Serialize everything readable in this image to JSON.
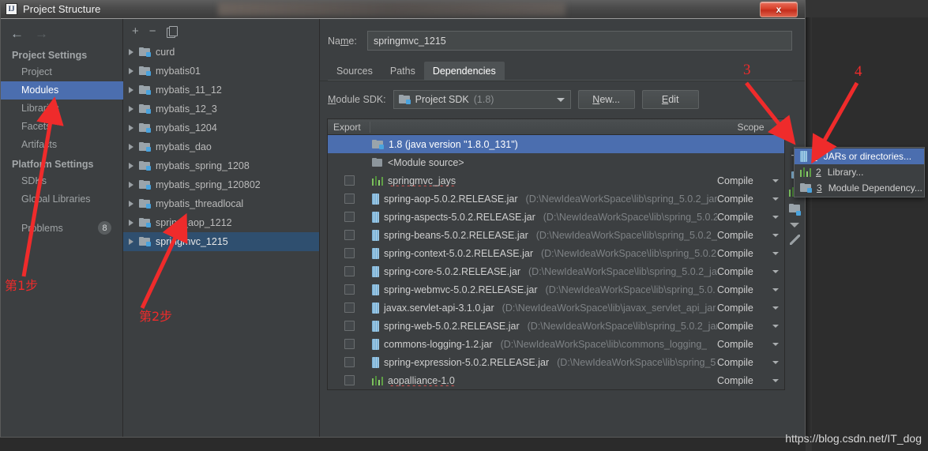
{
  "window": {
    "title": "Project Structure",
    "app_icon": "intellij-idea-icon",
    "close_label": "x"
  },
  "sidebar": {
    "back_icon": "arrow-left-icon",
    "forward_icon": "arrow-right-icon",
    "groups": [
      {
        "header": "Project Settings",
        "items": [
          {
            "label": "Project",
            "selected": false
          },
          {
            "label": "Modules",
            "selected": true
          },
          {
            "label": "Libraries",
            "selected": false
          },
          {
            "label": "Facets",
            "selected": false
          },
          {
            "label": "Artifacts",
            "selected": false
          }
        ]
      },
      {
        "header": "Platform Settings",
        "items": [
          {
            "label": "SDKs",
            "selected": false
          },
          {
            "label": "Global Libraries",
            "selected": false
          }
        ]
      }
    ],
    "problems": {
      "label": "Problems",
      "count": "8"
    }
  },
  "modules_panel": {
    "toolbar": {
      "add": "+",
      "remove": "−",
      "copy_icon": "copy-icon"
    },
    "items": [
      {
        "label": "curd",
        "selected": false
      },
      {
        "label": "mybatis01",
        "selected": false
      },
      {
        "label": "mybatis_11_12",
        "selected": false
      },
      {
        "label": "mybatis_12_3",
        "selected": false
      },
      {
        "label": "mybatis_1204",
        "selected": false
      },
      {
        "label": "mybatis_dao",
        "selected": false
      },
      {
        "label": "mybatis_spring_1208",
        "selected": false
      },
      {
        "label": "mybatis_spring_120802",
        "selected": false
      },
      {
        "label": "mybatis_threadlocal",
        "selected": false
      },
      {
        "label": "spring_aop_1212",
        "selected": false
      },
      {
        "label": "springmvc_1215",
        "selected": true
      }
    ]
  },
  "main": {
    "name_label": "Name:",
    "name_value": "springmvc_1215",
    "tabs": [
      {
        "label": "Sources",
        "active": false
      },
      {
        "label": "Paths",
        "active": false
      },
      {
        "label": "Dependencies",
        "active": true
      }
    ],
    "sdk_label": "Module SDK:",
    "sdk_value": "Project SDK",
    "sdk_version": "(1.8)",
    "sdk_icon": "sdk-folder-icon",
    "buttons": {
      "new": "New...",
      "edit": "Edit"
    },
    "table": {
      "columns": [
        "Export",
        "",
        "Scope"
      ],
      "rows": [
        {
          "icon": "sdk-icon",
          "name": "1.8 (java version \"1.8.0_131\")",
          "path": "",
          "scope": "",
          "checkbox": false,
          "selected": true
        },
        {
          "icon": "module-source-icon",
          "name": "<Module source>",
          "path": "",
          "scope": "",
          "checkbox": false,
          "selected": false
        },
        {
          "icon": "library-icon",
          "name": "springmvc_jays",
          "path": "",
          "scope": "Compile",
          "checkbox": true,
          "selected": false
        },
        {
          "icon": "jar-icon",
          "name": "spring-aop-5.0.2.RELEASE.jar",
          "path": "(D:\\NewIdeaWorkSpace\\lib\\spring_5.0.2_jar",
          "scope": "Compile",
          "checkbox": true,
          "selected": false
        },
        {
          "icon": "jar-icon",
          "name": "spring-aspects-5.0.2.RELEASE.jar",
          "path": "(D:\\NewIdeaWorkSpace\\lib\\spring_5.0.2",
          "scope": "Compile",
          "checkbox": true,
          "selected": false
        },
        {
          "icon": "jar-icon",
          "name": "spring-beans-5.0.2.RELEASE.jar",
          "path": "(D:\\NewIdeaWorkSpace\\lib\\spring_5.0.2_j",
          "scope": "Compile",
          "checkbox": true,
          "selected": false
        },
        {
          "icon": "jar-icon",
          "name": "spring-context-5.0.2.RELEASE.jar",
          "path": "(D:\\NewIdeaWorkSpace\\lib\\spring_5.0.2",
          "scope": "Compile",
          "checkbox": true,
          "selected": false
        },
        {
          "icon": "jar-icon",
          "name": "spring-core-5.0.2.RELEASE.jar",
          "path": "(D:\\NewIdeaWorkSpace\\lib\\spring_5.0.2_ja",
          "scope": "Compile",
          "checkbox": true,
          "selected": false
        },
        {
          "icon": "jar-icon",
          "name": "spring-webmvc-5.0.2.RELEASE.jar",
          "path": "(D:\\NewIdeaWorkSpace\\lib\\spring_5.0.",
          "scope": "Compile",
          "checkbox": true,
          "selected": false
        },
        {
          "icon": "jar-icon",
          "name": "javax.servlet-api-3.1.0.jar",
          "path": "(D:\\NewIdeaWorkSpace\\lib\\javax_servlet_api_jar",
          "scope": "Compile",
          "checkbox": true,
          "selected": false
        },
        {
          "icon": "jar-icon",
          "name": "spring-web-5.0.2.RELEASE.jar",
          "path": "(D:\\NewIdeaWorkSpace\\lib\\spring_5.0.2_jar",
          "scope": "Compile",
          "checkbox": true,
          "selected": false
        },
        {
          "icon": "jar-icon",
          "name": "commons-logging-1.2.jar",
          "path": "(D:\\NewIdeaWorkSpace\\lib\\commons_logging_",
          "scope": "Compile",
          "checkbox": true,
          "selected": false
        },
        {
          "icon": "jar-icon",
          "name": "spring-expression-5.0.2.RELEASE.jar",
          "path": "(D:\\NewIdeaWorkSpace\\lib\\spring_5",
          "scope": "Compile",
          "checkbox": true,
          "selected": false
        },
        {
          "icon": "library-icon",
          "name": "aopalliance-1.0",
          "path": "",
          "scope": "Compile",
          "checkbox": true,
          "selected": false
        }
      ]
    },
    "vtoolbar": {
      "add": "+",
      "down_icon": "chevron-down-icon",
      "edit_icon": "pencil-icon"
    }
  },
  "popup_menu": {
    "items": [
      {
        "num": "1",
        "label": "JARs or directories...",
        "icon": "jar-icon",
        "active": true
      },
      {
        "num": "2",
        "label": "Library...",
        "icon": "library-icon",
        "active": false
      },
      {
        "num": "3",
        "label": "Module Dependency...",
        "icon": "module-icon",
        "active": false
      }
    ]
  },
  "annotations": [
    {
      "id": "step1",
      "text": "第1步"
    },
    {
      "id": "step2",
      "text": "第2步"
    },
    {
      "id": "num3",
      "text": "3"
    },
    {
      "id": "num4",
      "text": "4"
    }
  ],
  "watermark": "https://blog.csdn.net/IT_dog",
  "colors": {
    "dialog_bg": "#3c3f41",
    "selection_blue": "#4b6eaf",
    "inactive_selection": "#2f4f6f",
    "annotation_red": "#ef2b2b",
    "close_red": "#d8402a"
  }
}
